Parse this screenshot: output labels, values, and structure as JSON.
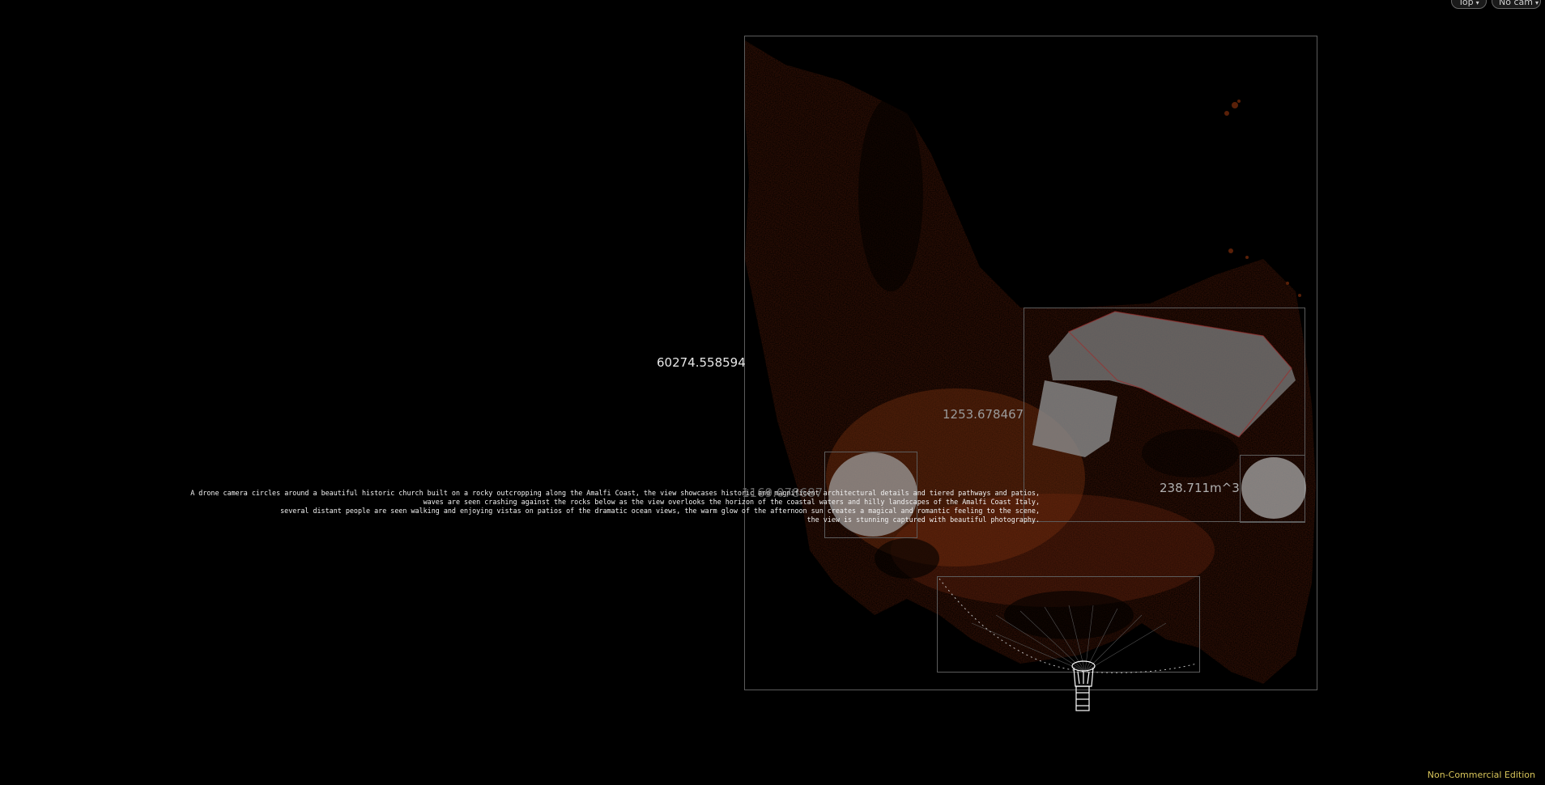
{
  "viewport": {
    "view_mode": "Top",
    "camera": "No cam",
    "accent_color": "#d8c55a",
    "background": "#000000"
  },
  "measurements": {
    "outer_dimension": "60274.558594",
    "building_dimension": "1253.678467",
    "left_volume_dimension": "1169.078687",
    "right_volume_dimension": "238.711m^3"
  },
  "caption": {
    "lines": [
      "A drone camera circles around a beautiful historic church built on a rocky outcropping along the Amalfi Coast, the view showcases historic and magnificent architectural details and tiered pathways and patios,",
      "waves are seen crashing against the rocks below as the view overlooks the horizon of the coastal waters and hilly landscapes of the Amalfi Coast Italy,",
      "several distant people are seen walking and enjoying vistas on patios of the dramatic ocean views, the warm glow of the afternoon sun creates a magical and romantic feeling to the scene,",
      "the view is stunning captured with beautiful photography."
    ]
  },
  "footer": {
    "edition_label": "Non-Commercial Edition"
  }
}
